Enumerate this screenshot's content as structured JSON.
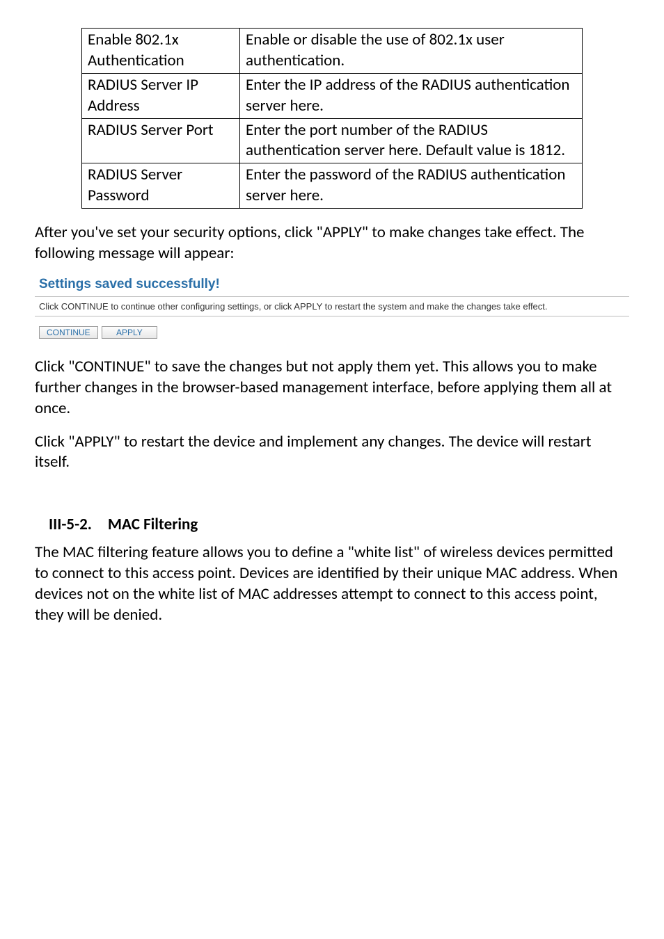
{
  "table": {
    "rows": [
      {
        "label": "Enable 802.1x Authentication",
        "desc": "Enable or disable the use of 802.1x user authentication."
      },
      {
        "label": "RADIUS Server IP Address",
        "desc": "Enter the IP address of the RADIUS authentication server here."
      },
      {
        "label": "RADIUS Server Port",
        "desc": "Enter the port number of the RADIUS authentication server here. Default value is 1812."
      },
      {
        "label": "RADIUS Server Password",
        "desc": "Enter the password of the RADIUS authentication server here."
      }
    ]
  },
  "para1": "After you've set your security options, click \"APPLY\" to make changes take effect. The following message will appear:",
  "saved": {
    "title": "Settings saved successfully!",
    "desc": "Click CONTINUE to continue other configuring settings, or click APPLY to restart the system and make the changes take effect.",
    "continue_label": "CONTINUE",
    "apply_label": "APPLY"
  },
  "para2": "Click \"CONTINUE\" to save the changes but not apply them yet. This allows you to make further changes in the browser-based management interface, before applying them all at once.",
  "para3": "Click \"APPLY\" to restart the device and implement any changes. The device will restart itself.",
  "section_heading": "III-5-2. MAC Filtering",
  "para4": "The MAC filtering feature allows you to define a \"white list\" of wireless devices permitted to connect to this access point. Devices are identified by their unique MAC address. When devices not on the white list of MAC addresses attempt to connect to this access point, they will be denied."
}
